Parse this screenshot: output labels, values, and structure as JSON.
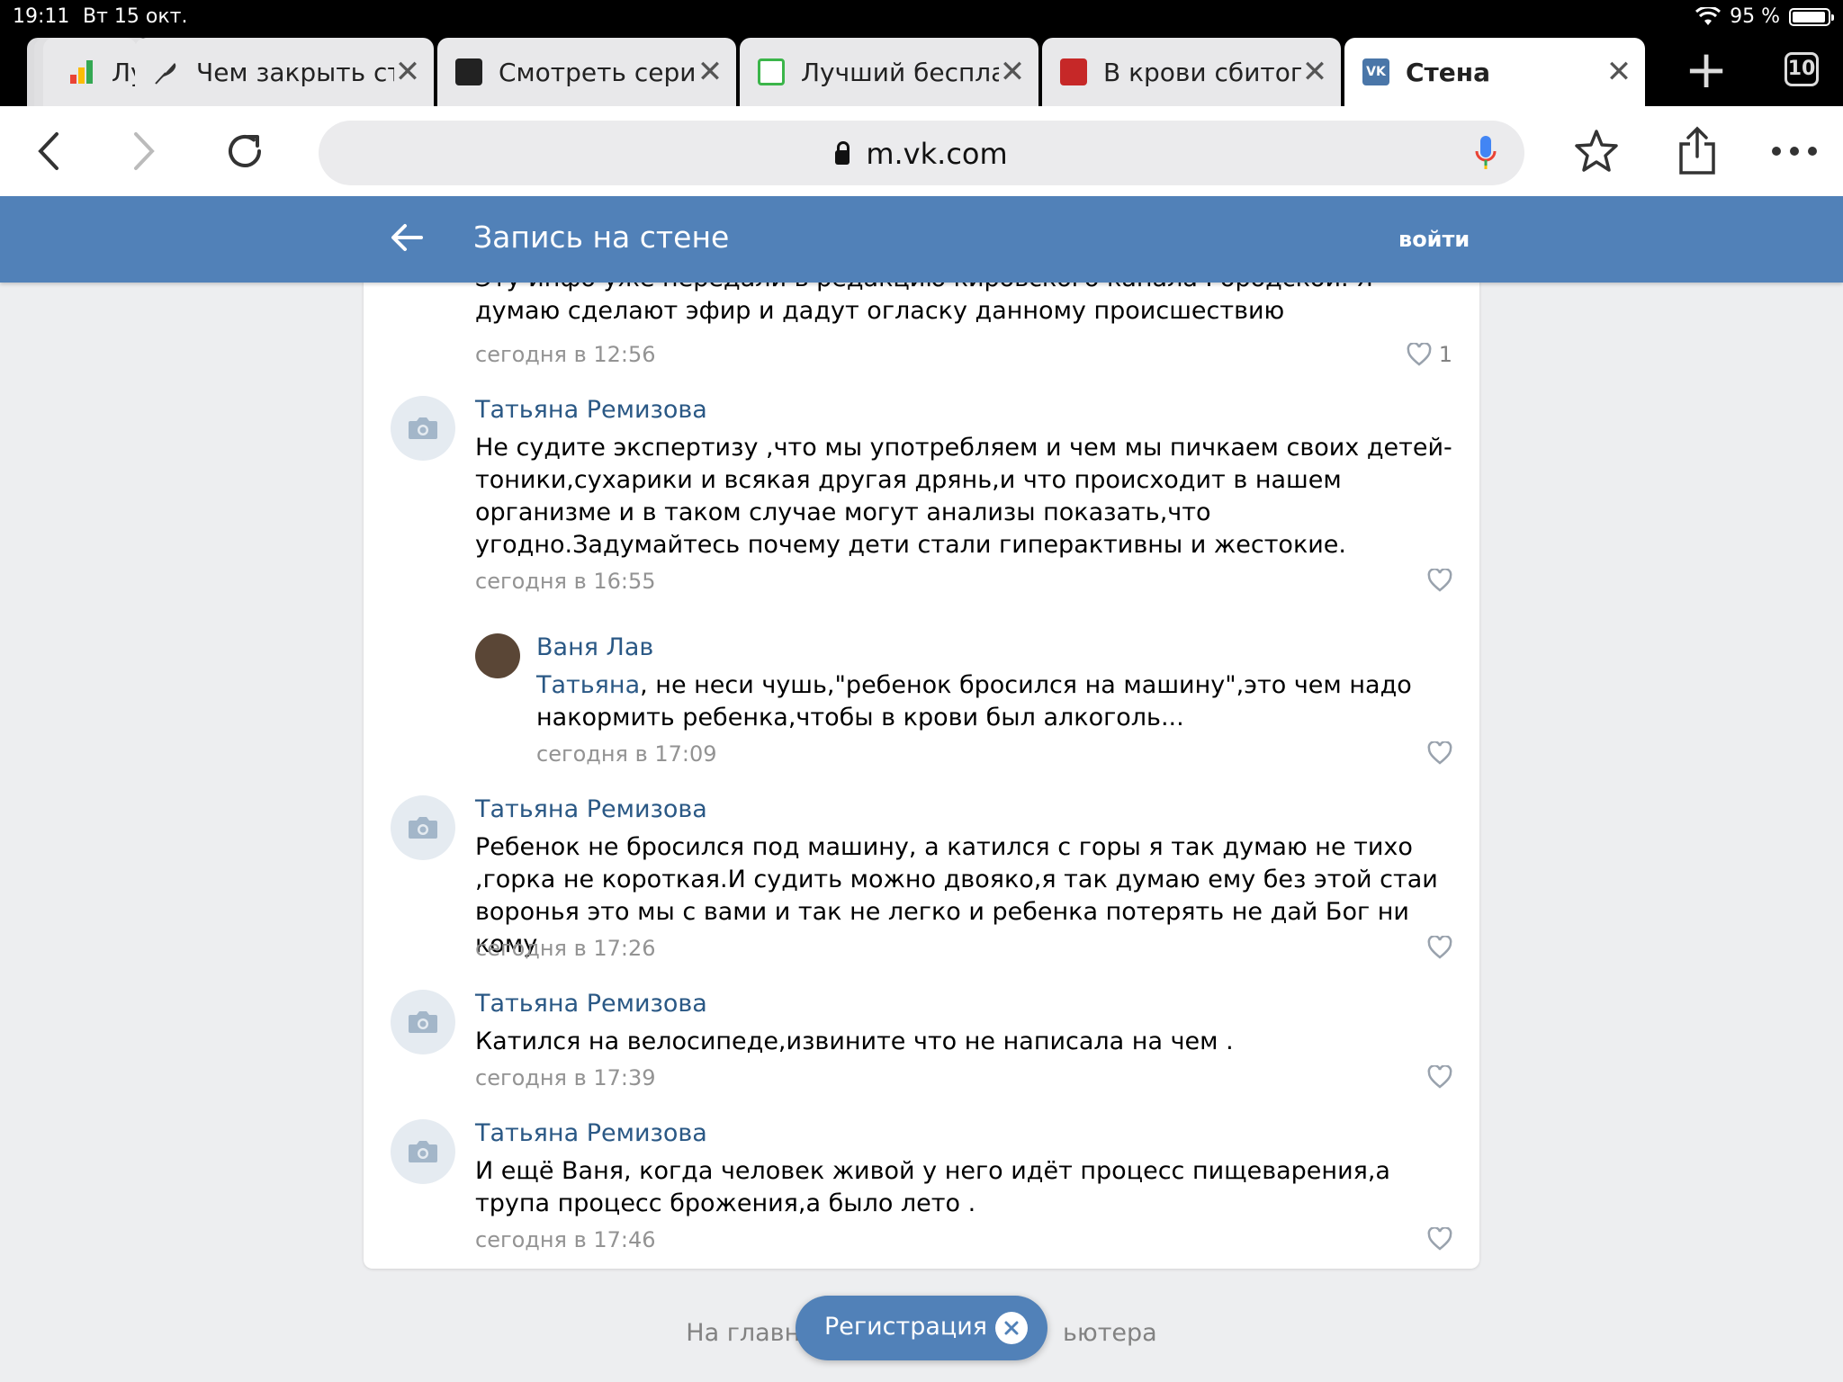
{
  "status": {
    "time": "19:11",
    "date": "Вт 15 окт.",
    "battery": "95 %",
    "battery_level": 0.95
  },
  "tabs": [
    {
      "title": "Лу",
      "icon": "bar-chart-icon",
      "color": "#34a853"
    },
    {
      "title": "Чем закрыть ст",
      "icon": "feather-icon",
      "color": "#333333"
    },
    {
      "title": "Смотреть сери",
      "icon": "tv-icon",
      "color": "#222222"
    },
    {
      "title": "Лучший беспла",
      "icon": "document-icon",
      "color": "#3bb54a"
    },
    {
      "title": "В крови сбитог",
      "icon": "news-icon",
      "color": "#c62828"
    },
    {
      "title": "Стена",
      "icon": "vk-logo-icon",
      "color": "#4a76a8",
      "active": true
    }
  ],
  "tab_count": "10",
  "address": {
    "url": "m.vk.com"
  },
  "header": {
    "title": "Запись на стене",
    "login": "войти"
  },
  "comments": [
    {
      "author": "",
      "text": "Эту инфо уже передали в редакцию кировского канала Городской. Я думаю сделают эфир и дадут огласку данному происшествию",
      "time": "сегодня в 12:56",
      "likes": "1"
    },
    {
      "author": "Татьяна Ремизова",
      "text": "Не судите экспертизу ,что мы употребляем и чем мы пичкаем своих детей-тоники,сухарики и всякая другая дрянь,и что происходит в нашем организме и в таком случае могут анализы показать,что угодно.Задумайтесь почему дети стали гиперактивны и жестокие.",
      "time": "сегодня в 16:55",
      "likes": ""
    },
    {
      "author": "Ваня Лав",
      "mention": "Татьяна",
      "text": ", не неси чушь,\"ребенок бросился на машину\",это чем надо накормить ребенка,чтобы в крови был алкоголь...",
      "time": "сегодня в 17:09",
      "likes": ""
    },
    {
      "author": "Татьяна Ремизова",
      "text": "Ребенок не бросился под машину, а катился с горы я так думаю не тихо ,горка не короткая.И судить можно двояко,я так думаю ему без этой стаи воронья это мы с вами и так не легко и ребенка потерять не дай Бог ни кому",
      "time": "сегодня в 17:26",
      "likes": ""
    },
    {
      "author": "Татьяна Ремизова",
      "text": "Катился на велосипеде,извините что не написала на чем .",
      "time": "сегодня в 17:39",
      "likes": ""
    },
    {
      "author": "Татьяна Ремизова",
      "text": "И ещё Ваня, когда человек живой у него идёт процесс пищеварения,а трупа процесс брожения,а было лето .",
      "time": "сегодня в 17:46",
      "likes": ""
    }
  ],
  "footer": {
    "text": "На главн                                  ьютера"
  },
  "register": {
    "label": "Регистрация"
  },
  "colors": {
    "vk_blue": "#5181b8",
    "link": "#2a5885",
    "page_bg": "#edeef0"
  }
}
